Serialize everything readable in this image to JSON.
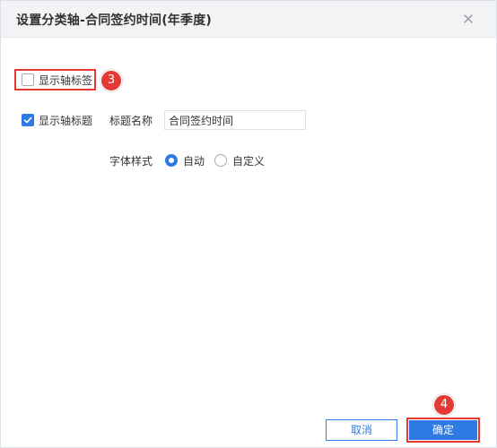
{
  "dialog": {
    "title": "设置分类轴-合同签约时间(年季度)",
    "close_icon": "close-icon"
  },
  "show_axis_label": {
    "label": "显示轴标签",
    "checked": false,
    "step_number": "3"
  },
  "show_axis_title": {
    "label": "显示轴标题",
    "checked": true
  },
  "title_name": {
    "label": "标题名称",
    "value": "合同签约时间"
  },
  "font_style": {
    "label": "字体样式",
    "options": [
      {
        "label": "自动",
        "selected": true
      },
      {
        "label": "自定义",
        "selected": false
      }
    ]
  },
  "footer": {
    "cancel_label": "取消",
    "ok_label": "确定",
    "step_number": "4"
  },
  "colors": {
    "accent": "#2f7ae5",
    "highlight": "#e53935",
    "title_bar": "#f2f3f5"
  }
}
